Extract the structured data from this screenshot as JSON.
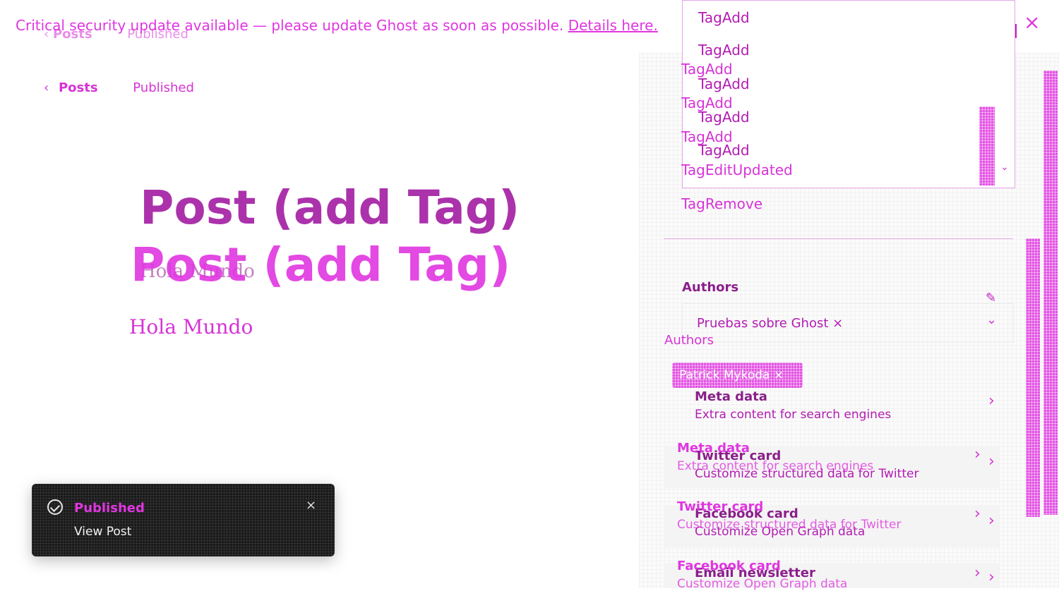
{
  "alert": {
    "message": "Critical security update available — please update Ghost as soon as possible.",
    "link_text": "Details here."
  },
  "header": {
    "back_label": "Posts",
    "status": "Published"
  },
  "editor": {
    "title": "Post (add Tag)",
    "title_ghost": "Post (add Tag)",
    "body_placeholder": "Hola Mundo",
    "body_text": "Hola Mundo"
  },
  "tags_dropdown": {
    "items": [
      "TagAdd",
      "TagAdd",
      "TagAdd",
      "TagAdd",
      "TagAdd"
    ]
  },
  "tag_list": {
    "items": [
      "TagAdd",
      "TagAdd",
      "TagAdd",
      "TagEditUpdated",
      "TagRemove"
    ]
  },
  "authors": {
    "label": "Authors",
    "label_ghost": "Authors",
    "token": "Pruebas sobre Ghost ×",
    "chip": "Patrick Mykoda ×"
  },
  "cards": [
    {
      "title": "Meta data",
      "subtitle": "Extra content for search engines"
    },
    {
      "title": "Twitter card",
      "subtitle": "Customize structured data for Twitter"
    },
    {
      "title": "Facebook card",
      "subtitle": "Customize Open Graph data"
    },
    {
      "title": "Email newsletter",
      "subtitle": ""
    }
  ],
  "cards_ghost": [
    {
      "title": "Meta data",
      "subtitle": "Extra content for search engines"
    },
    {
      "title": "Twitter card",
      "subtitle": "Customize structured data for Twitter"
    },
    {
      "title": "Facebook card",
      "subtitle": "Customize Open Graph data"
    }
  ],
  "toast": {
    "title": "Published",
    "link": "View Post"
  },
  "icons": {
    "close": "×",
    "chevron_right": "›",
    "chevron_down": "⌄",
    "back": "‹"
  },
  "colors": {
    "accent": "#e036e0",
    "dark": "#8a1f8a",
    "toast_bg": "#1a1a1a"
  }
}
